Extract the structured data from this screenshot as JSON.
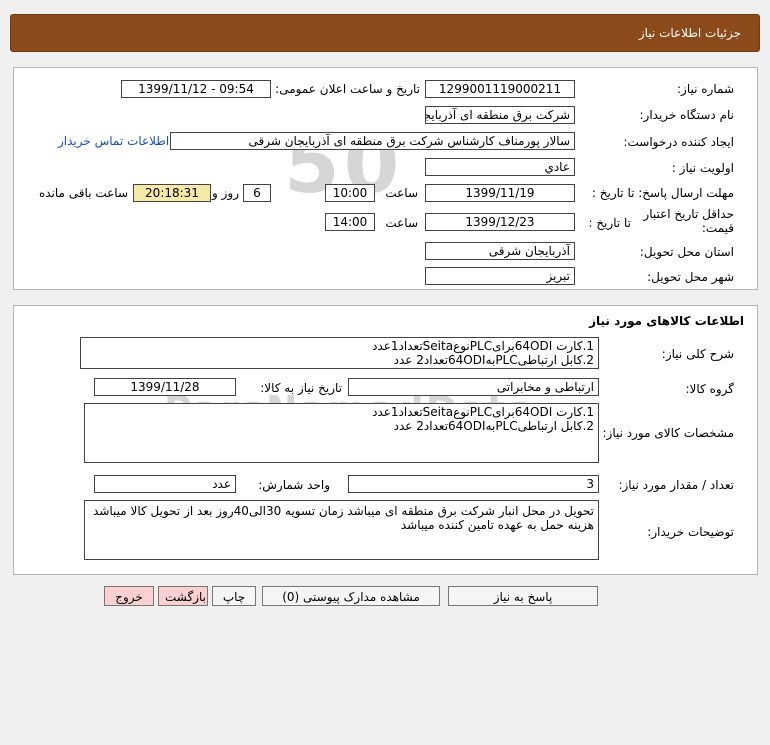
{
  "page_title": "جزئیات اطلاعات نیاز",
  "info": {
    "need_number_label": "شماره نیاز:",
    "need_number": "1299001119000211",
    "announce_label": "تاریخ و ساعت اعلان عمومی:",
    "announce_value": "1399/11/12 - 09:54",
    "buyer_label": "نام دستگاه خریدار:",
    "buyer": "شرکت برق منطقه ای آذربایجان شرقی",
    "requester_label": "ایجاد کننده درخواست:",
    "requester": "سالار پورمناف کارشناس شرکت برق منطقه ای آذربایجان شرقی",
    "contact_link": "اطلاعات تماس خریدار",
    "priority_label": "اولویت نیاز :",
    "priority": "عادي",
    "deadline_label": "مهلت ارسال پاسخ: تا تاریخ :",
    "deadline_date": "1399/11/19",
    "time_label": "ساعت",
    "deadline_time": "10:00",
    "days_value": "6",
    "days_label": "روز و",
    "remaining_time": "20:18:31",
    "remaining_label": "ساعت باقی مانده",
    "validity_label": "حداقل تاریخ اعتبار قیمت:",
    "validity_to_label": "تا تاریخ :",
    "validity_date": "1399/12/23",
    "validity_time_label": "ساعت",
    "validity_time": "14:00",
    "province_label": "استان محل تحویل:",
    "province": "آذربایجان شرقی",
    "city_label": "شهر محل تحویل:",
    "city": "تبریز"
  },
  "goods": {
    "section_title": "اطلاعات کالاهای مورد نیاز",
    "summary_label": "شرح کلی نیاز:",
    "summary_line1": "1.کارت 64ODIبرایPLCنوعSeitaتعداد1عدد",
    "summary_line2": "2.کابل ارتباطیPLCبه64ODIتعداد2 عدد",
    "group_label": "گروه کالا:",
    "group": "ارتباطی و مخابراتی",
    "need_date_label": "تاریخ نیاز به کالا:",
    "need_date": "1399/11/28",
    "spec_label": "مشخصات کالای مورد نیاز:",
    "spec_line1": "1.کارت 64ODIبرایPLCنوعSeitaتعداد1عدد",
    "spec_line2": "2.کابل ارتباطیPLCبه64ODIتعداد2 عدد",
    "qty_label": "تعداد / مقدار مورد نیاز:",
    "qty": "3",
    "unit_label": "واحد شمارش:",
    "unit": "عدد",
    "notes_label": "توضیحات خریدار:",
    "notes_line1": "تحویل در محل انبار شرکت برق منطقه ای میباشد زمان تسویه 30الی40روز بعد از تحویل کالا میباشد",
    "notes_line2": "هزینه حمل به عهده تامین کننده میباشد"
  },
  "buttons": {
    "reply": "پاسخ به نیاز",
    "attachments": "مشاهده مدارک پیوستی (0)",
    "print": "چاپ",
    "back": "بازگشت",
    "exit": "خروج"
  },
  "watermark": "ParsNamadData"
}
